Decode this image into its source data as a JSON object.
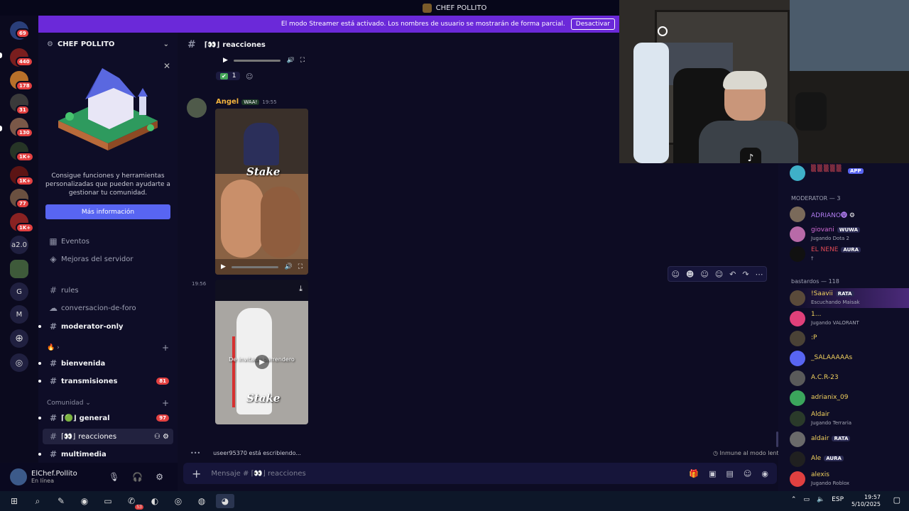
{
  "window": {
    "title": "CHEF POLLITO"
  },
  "banner": {
    "text": "El modo Streamer está activado. Los nombres de usuario se mostrarán de forma parcial.",
    "button": "Desactivar"
  },
  "servers": [
    {
      "badge": "69"
    },
    {
      "badge": "440"
    },
    {
      "badge": "178"
    },
    {
      "badge": "31"
    },
    {
      "badge": "130"
    },
    {
      "badge": "1K+"
    },
    {
      "badge": "1K+"
    },
    {
      "badge": "77"
    },
    {
      "badge": "1K+"
    },
    {
      "label": "a2.0"
    },
    {
      "label": ""
    },
    {
      "label": "G"
    },
    {
      "label": "M"
    }
  ],
  "sidebar": {
    "server_name": "CHEF POLLITO",
    "promo_text": "Consigue funciones y herramientas personalizadas que pueden ayudarte a gestionar tu comunidad.",
    "promo_button": "Más información",
    "items": [
      {
        "label": "Eventos"
      },
      {
        "label": "Mejoras del servidor"
      },
      {
        "label": "rules"
      },
      {
        "label": "conversacion-de-foro"
      },
      {
        "label": "moderator-only"
      },
      {
        "label": "bienvenida"
      },
      {
        "label": "transmisiones",
        "badge": "81"
      },
      {
        "label": "general",
        "prefix": "⌈🟢⌋",
        "badge": "97"
      },
      {
        "label": "reacciones",
        "prefix": "⌈👀⌋"
      },
      {
        "label": "multimedia"
      }
    ],
    "category_community": "Comunidad"
  },
  "user": {
    "name": "ElChef.Pollito",
    "status": "En línea"
  },
  "chat": {
    "channel_prefix": "⌈👀⌋",
    "channel_name": "reacciones",
    "reaction_count": "1",
    "message_author": "Angel",
    "author_tag": "WAA!",
    "message_time": "19:55",
    "second_time": "19:56",
    "stake_label": "Stake",
    "video_caption": "De invitado barrendero"
  },
  "typing": "useer95370 está escribiendo...",
  "slowmode": "Inmune al modo lento",
  "composer": {
    "placeholder": "Mensaje # ⌈👀⌋ reacciones"
  },
  "members": {
    "top_tag": "APP",
    "categories": [
      {
        "label": "MODERATOR — 3"
      },
      {
        "label": "bastardos — 118"
      }
    ],
    "list": [
      {
        "name": "ADRIANO🅤",
        "color": "#b07cf0"
      },
      {
        "name": "giovani",
        "tag": "WUWA",
        "sub": "Jugando Dota 2",
        "color": "#d46bd6"
      },
      {
        "name": "EL NENE",
        "tag": "AURA",
        "sub": "†",
        "color": "#e04a55"
      },
      {
        "name": "!Saavii",
        "tag": "RATA",
        "sub": "Escuchando Maisak",
        "color": "#f2d25e"
      },
      {
        "name": "1...",
        "sub": "Jugando VALORANT",
        "color": "#f2d25e"
      },
      {
        "name": ":P",
        "color": "#f2d25e"
      },
      {
        "name": "_SALAAAAAs",
        "color": "#f2d25e"
      },
      {
        "name": "A.C.R-23",
        "color": "#f2d25e"
      },
      {
        "name": "adrianix_09",
        "color": "#f2d25e"
      },
      {
        "name": "Aldair",
        "sub": "Jugando Terraria",
        "color": "#f2d25e"
      },
      {
        "name": "aldair",
        "tag": "RATA",
        "color": "#f2d25e"
      },
      {
        "name": "Ale",
        "tag": "AURA",
        "color": "#f2d25e"
      },
      {
        "name": "alexis",
        "sub": "Jugando Roblox",
        "color": "#f2d25e"
      }
    ]
  },
  "taskbar": {
    "time": "19:57",
    "date": "5/10/2025",
    "lang": "ESP",
    "whatsapp_badge": "53"
  }
}
